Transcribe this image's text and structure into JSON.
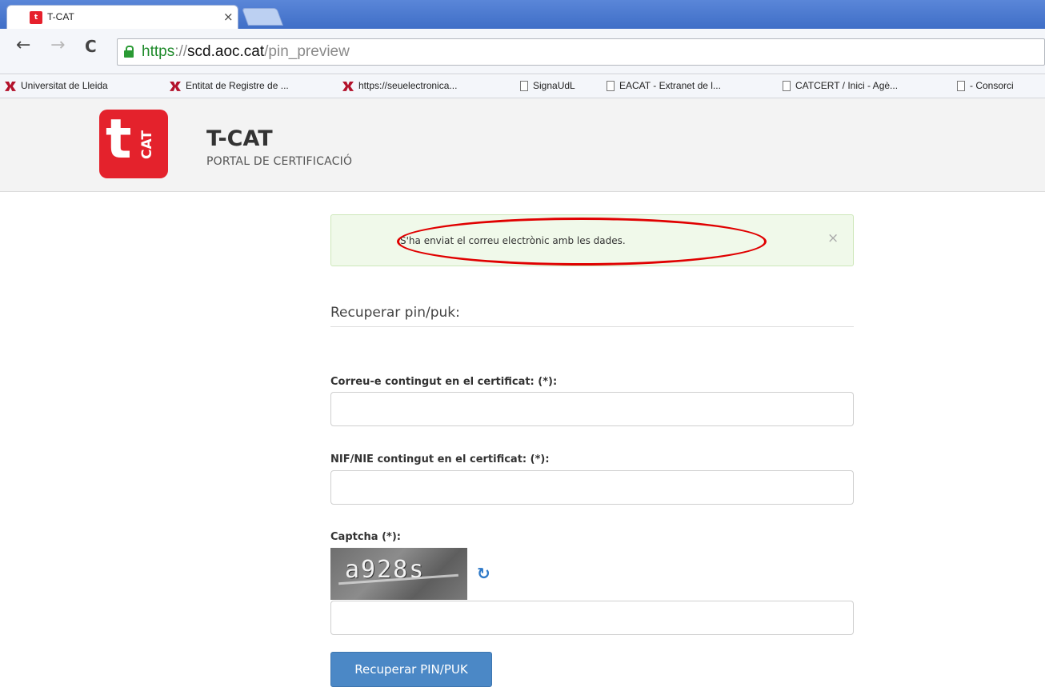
{
  "browser": {
    "tab_title": "T-CAT",
    "tab_close": "×",
    "url_scheme": "https",
    "url_separator": "://",
    "url_host": "scd.aoc.cat",
    "url_path": "/pin_preview",
    "bookmarks": [
      {
        "label": "Universitat de Lleida",
        "icon": "udl-icon"
      },
      {
        "label": "Entitat de Registre de ...",
        "icon": "udl-icon"
      },
      {
        "label": "https://seuelectronica...",
        "icon": "udl-icon"
      },
      {
        "label": "SignaUdL",
        "icon": "page-icon"
      },
      {
        "label": "EACAT - Extranet de l...",
        "icon": "page-icon"
      },
      {
        "label": "CATCERT / Inici - Agè...",
        "icon": "page-icon"
      },
      {
        "label": "- Consorci",
        "icon": "page-icon"
      }
    ]
  },
  "header": {
    "logo_t": "t",
    "logo_cat": "CAT",
    "title": "T-CAT",
    "subtitle": "PORTAL DE CERTIFICACIÓ"
  },
  "alert": {
    "message": "S'ha enviat el correu electrònic amb les dades.",
    "close": "×"
  },
  "form": {
    "section_title": "Recuperar pin/puk:",
    "email_label": "Correu-e contingut en el certificat: (*):",
    "email_value": "",
    "nif_label": "NIF/NIE contingut en el certificat: (*):",
    "nif_value": "",
    "captcha_label": "Captcha (*):",
    "captcha_text": "a928s",
    "captcha_value": "",
    "submit_label": "Recuperar PIN/PUK"
  },
  "colors": {
    "brand_red": "#e4222c",
    "alert_bg": "#f0f9ea",
    "button_blue": "#4b88c6",
    "annotation_red": "#e00000"
  }
}
